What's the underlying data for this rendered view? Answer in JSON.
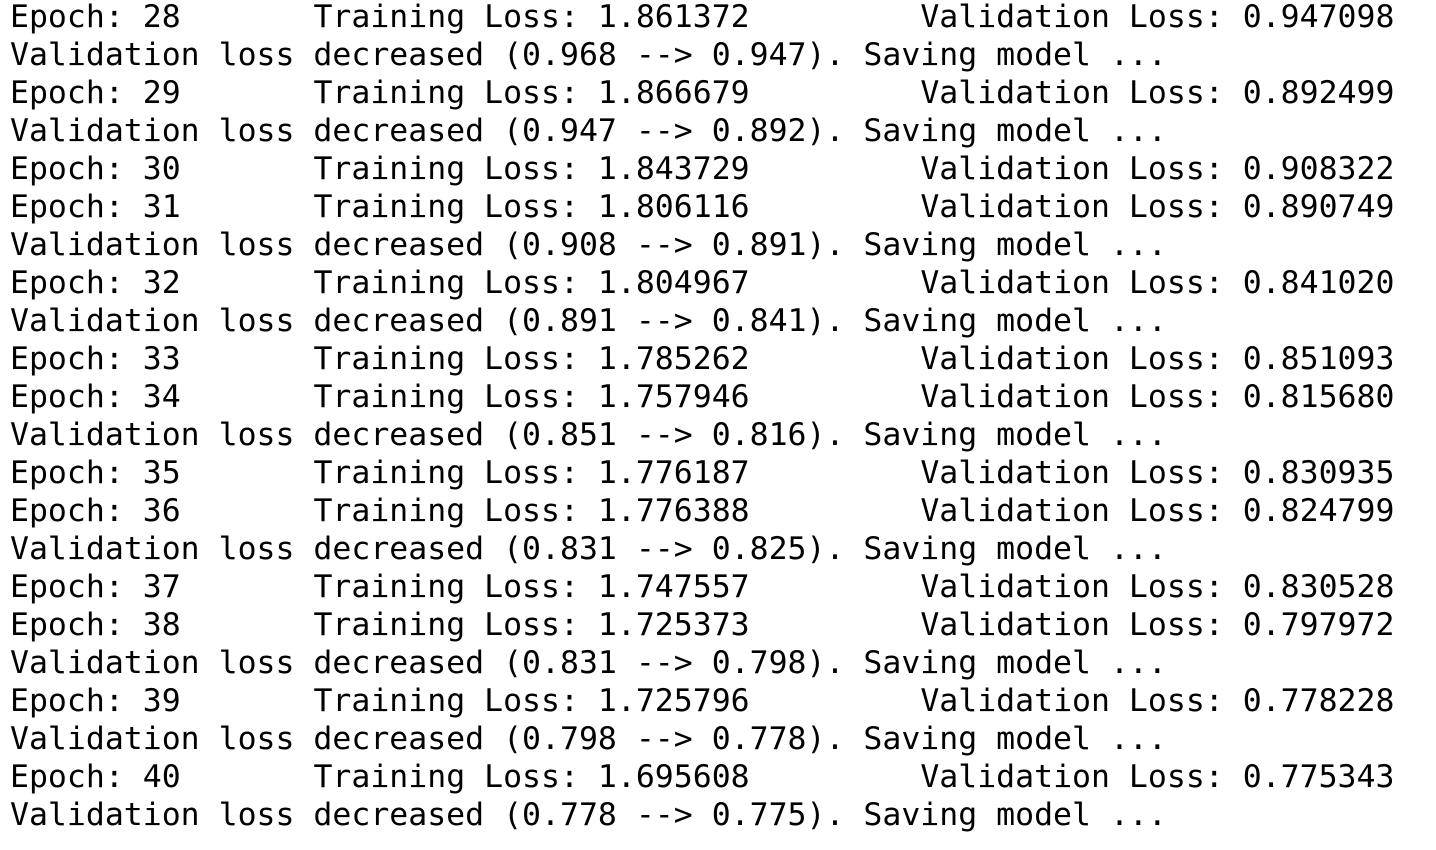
{
  "output": {
    "lines": [
      "Epoch: 28 \tTraining Loss: 1.861372 \tValidation Loss: 0.947098",
      "Validation loss decreased (0.968 --> 0.947). Saving model ...",
      "Epoch: 29 \tTraining Loss: 1.866679 \tValidation Loss: 0.892499",
      "Validation loss decreased (0.947 --> 0.892). Saving model ...",
      "Epoch: 30 \tTraining Loss: 1.843729 \tValidation Loss: 0.908322",
      "Epoch: 31 \tTraining Loss: 1.806116 \tValidation Loss: 0.890749",
      "Validation loss decreased (0.908 --> 0.891). Saving model ...",
      "Epoch: 32 \tTraining Loss: 1.804967 \tValidation Loss: 0.841020",
      "Validation loss decreased (0.891 --> 0.841). Saving model ...",
      "Epoch: 33 \tTraining Loss: 1.785262 \tValidation Loss: 0.851093",
      "Epoch: 34 \tTraining Loss: 1.757946 \tValidation Loss: 0.815680",
      "Validation loss decreased (0.851 --> 0.816). Saving model ...",
      "Epoch: 35 \tTraining Loss: 1.776187 \tValidation Loss: 0.830935",
      "Epoch: 36 \tTraining Loss: 1.776388 \tValidation Loss: 0.824799",
      "Validation loss decreased (0.831 --> 0.825). Saving model ...",
      "Epoch: 37 \tTraining Loss: 1.747557 \tValidation Loss: 0.830528",
      "Epoch: 38 \tTraining Loss: 1.725373 \tValidation Loss: 0.797972",
      "Validation loss decreased (0.831 --> 0.798). Saving model ...",
      "Epoch: 39 \tTraining Loss: 1.725796 \tValidation Loss: 0.778228",
      "Validation loss decreased (0.798 --> 0.778). Saving model ...",
      "Epoch: 40 \tTraining Loss: 1.695608 \tValidation Loss: 0.775343",
      "Validation loss decreased (0.778 --> 0.775). Saving model ..."
    ]
  }
}
